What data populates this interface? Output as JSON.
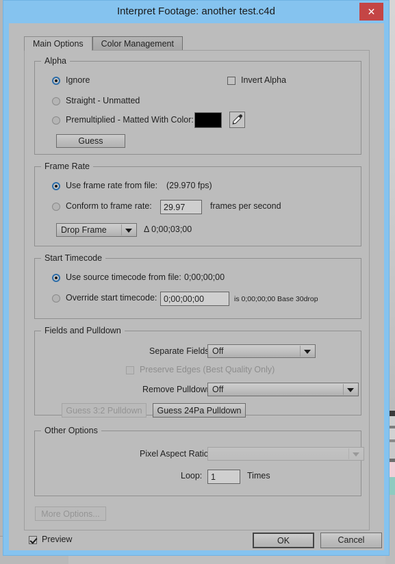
{
  "window": {
    "title": "Interpret Footage: another test.c4d",
    "close_label": "✕",
    "titlebar_color": "#85c3ef",
    "close_color": "#c44545"
  },
  "tabs": [
    {
      "label": "Main Options",
      "active": true
    },
    {
      "label": "Color Management",
      "active": false
    }
  ],
  "alpha": {
    "group_title": "Alpha",
    "ignore_label": "Ignore",
    "straight_label": "Straight - Unmatted",
    "premultiplied_label": "Premultiplied - Matted With Color:",
    "invert_alpha_label": "Invert Alpha",
    "guess_label": "Guess",
    "matte_color": "#000000",
    "eyedropper_icon": "eyedropper-icon"
  },
  "frame_rate": {
    "group_title": "Frame Rate",
    "use_from_file_label": "Use frame rate from file:",
    "use_from_file_value": "(29.970 fps)",
    "conform_label": "Conform to frame rate:",
    "conform_value": "29.97",
    "fps_suffix": "frames per second",
    "timecode_mode": "Drop Frame",
    "delta_label": "Δ 0;00;03;00"
  },
  "start_timecode": {
    "group_title": "Start Timecode",
    "use_source_label": "Use source timecode from file:",
    "use_source_value": "0;00;00;00",
    "override_label": "Override start timecode:",
    "override_value": "0;00;00;00",
    "override_info": "is 0;00;00;00  Base 30drop"
  },
  "fields_pulldown": {
    "group_title": "Fields and Pulldown",
    "separate_fields_label": "Separate Fields:",
    "separate_fields_value": "Off",
    "preserve_edges_label": "Preserve Edges (Best Quality Only)",
    "remove_pulldown_label": "Remove Pulldown:",
    "remove_pulldown_value": "Off",
    "guess_32_label": "Guess 3:2 Pulldown",
    "guess_24pa_label": "Guess 24Pa Pulldown"
  },
  "other_options": {
    "group_title": "Other Options",
    "pixel_aspect_label": "Pixel Aspect Ratio:",
    "pixel_aspect_value": "",
    "loop_label": "Loop:",
    "loop_value": "1",
    "times_label": "Times",
    "more_options_label": "More Options..."
  },
  "footer": {
    "preview_label": "Preview",
    "ok_label": "OK",
    "cancel_label": "Cancel"
  }
}
